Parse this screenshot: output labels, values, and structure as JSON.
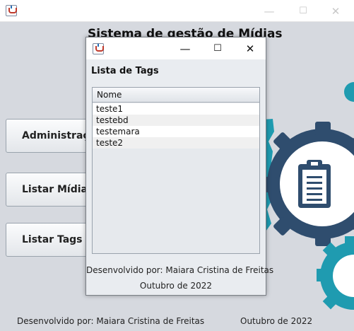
{
  "main_window": {
    "title_controls": {
      "minimize": "—",
      "maximize": "☐",
      "close": "✕"
    },
    "app_title": "Sistema de gestão de Mídias",
    "buttons": [
      {
        "label": "Administração"
      },
      {
        "label": "Listar Mídias"
      },
      {
        "label": "Listar Tags"
      }
    ],
    "footer": {
      "developer": "Desenvolvido por: Maiara Cristina de Freitas",
      "date": "Outubro de 2022"
    },
    "colors": {
      "gear_dark": "#2f4d6e",
      "gear_teal": "#1f9bb0",
      "background": "#d6d9df"
    },
    "icons": [
      "java-icon",
      "gear-icon",
      "clipboard-icon"
    ]
  },
  "dialog": {
    "title_controls": {
      "minimize": "—",
      "maximize": "☐",
      "close": "✕"
    },
    "heading": "Lista de Tags",
    "table": {
      "columns": [
        "Nome"
      ],
      "rows": [
        "teste1",
        "testebd",
        "testemara",
        "teste2"
      ]
    },
    "footer": {
      "developer": "Desenvolvido por: Maiara Cristina de Freitas",
      "date": "Outubro de 2022"
    }
  }
}
